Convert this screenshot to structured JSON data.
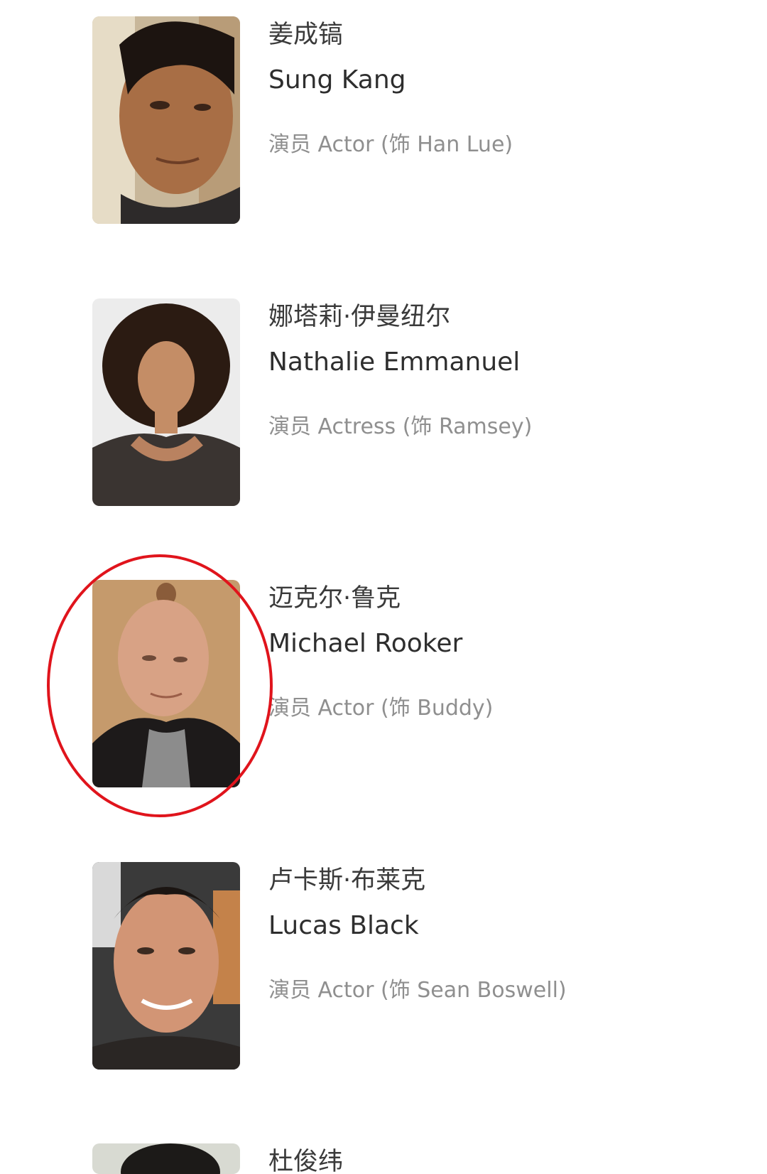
{
  "cast": [
    {
      "name_cn": "姜成镐",
      "name_en": "Sung Kang",
      "role": "演员 Actor (饰 Han Lue)"
    },
    {
      "name_cn": "娜塔莉·伊曼纽尔",
      "name_en": "Nathalie Emmanuel",
      "role": "演员 Actress (饰 Ramsey)"
    },
    {
      "name_cn": "迈克尔·鲁克",
      "name_en": "Michael Rooker",
      "role": "演员 Actor (饰 Buddy)"
    },
    {
      "name_cn": "卢卡斯·布莱克",
      "name_en": "Lucas Black",
      "role": "演员 Actor (饰 Sean Boswell)"
    },
    {
      "name_cn": "杜俊纬"
    }
  ],
  "annotation": {
    "color": "#e0141c",
    "target": "Michael Rooker"
  }
}
